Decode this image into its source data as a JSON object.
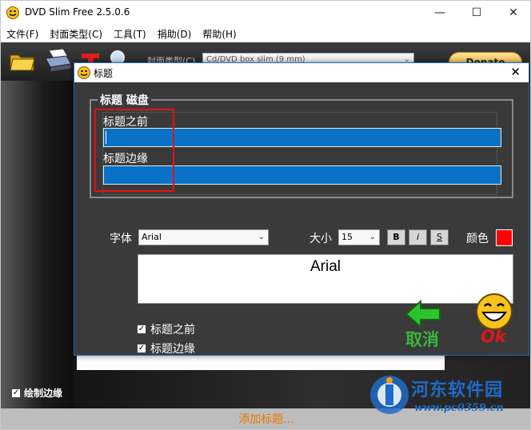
{
  "window": {
    "title": "DVD Slim Free 2.5.0.6"
  },
  "menu": [
    "文件(F)",
    "封面类型(C)",
    "工具(T)",
    "捐助(D)",
    "帮助(H)"
  ],
  "toolbar": {
    "cover_type_label": "封面类型(C)",
    "cover_type_value": "Cd/DVD box slim (9 mm)",
    "donate_label": "Donate"
  },
  "workspace": {
    "draw_border_label": "绘制边缘",
    "draw_border_checked": true
  },
  "status": {
    "add_title": "添加标题..."
  },
  "dialog": {
    "title": "标题",
    "group_title": "标题 磁盘",
    "title_before_label": "标题之前",
    "title_before_value": "",
    "title_edge_label": "标题边缘",
    "title_edge_value": "",
    "font_label": "字体",
    "font_value": "Arial",
    "size_label": "大小",
    "size_value": "15",
    "bold_label": "B",
    "italic_label": "i",
    "strike_label": "S",
    "color_label": "颜色",
    "color_value": "#ff0000",
    "preview_text": "Arial",
    "check_title_before": "标题之前",
    "check_title_edge": "标题边缘",
    "cancel_label": "取消",
    "ok_label": "Ok"
  },
  "watermark": {
    "text": "河东软件园",
    "url": "www.pc0359.cn"
  }
}
